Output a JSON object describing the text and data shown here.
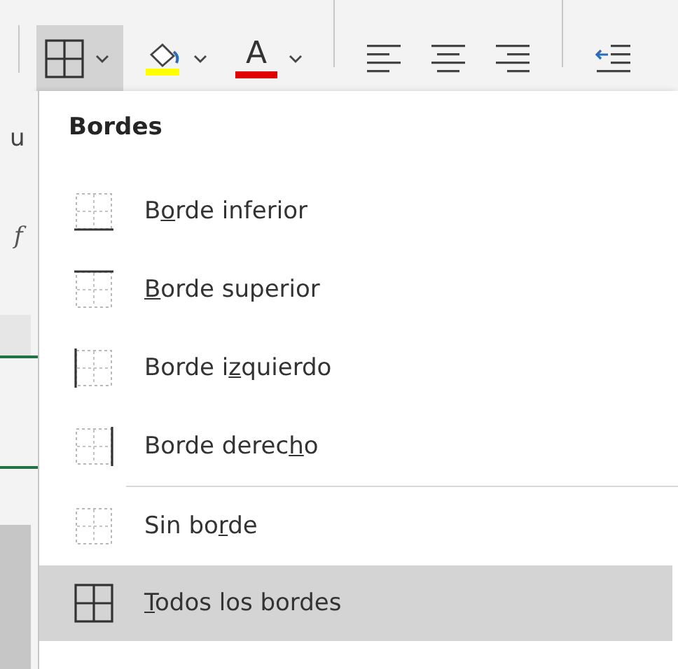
{
  "toolbar": {
    "items": [
      {
        "kind": "borders",
        "pressed": true
      },
      {
        "kind": "fill-color",
        "color": "#ffff00"
      },
      {
        "kind": "font-color",
        "glyph": "A",
        "color": "#e00000"
      },
      {
        "kind": "separator"
      },
      {
        "kind": "align-left"
      },
      {
        "kind": "align-center"
      },
      {
        "kind": "align-right"
      },
      {
        "kind": "separator"
      },
      {
        "kind": "indent"
      }
    ]
  },
  "sheet_edge": {
    "texts": [
      "u",
      "f"
    ]
  },
  "menu": {
    "heading": "Bordes",
    "items": [
      {
        "kind": "bottom",
        "label_parts": [
          {
            "text": "B",
            "underlined": false
          },
          {
            "text": "o",
            "underlined": true
          },
          {
            "text": "rde inferior",
            "underlined": false
          }
        ],
        "separator_before": false,
        "selected": false
      },
      {
        "kind": "top",
        "label_parts": [
          {
            "text": "B",
            "underlined": true
          },
          {
            "text": "orde superior",
            "underlined": false
          }
        ],
        "separator_before": false,
        "selected": false
      },
      {
        "kind": "left",
        "label_parts": [
          {
            "text": "Borde i",
            "underlined": false
          },
          {
            "text": "z",
            "underlined": true
          },
          {
            "text": "quierdo",
            "underlined": false
          }
        ],
        "separator_before": false,
        "selected": false
      },
      {
        "kind": "right",
        "label_parts": [
          {
            "text": "Borde derec",
            "underlined": false
          },
          {
            "text": "h",
            "underlined": true
          },
          {
            "text": "o",
            "underlined": false
          }
        ],
        "separator_before": false,
        "selected": false
      },
      {
        "kind": "none",
        "label_parts": [
          {
            "text": "Sin bo",
            "underlined": false
          },
          {
            "text": "r",
            "underlined": true
          },
          {
            "text": "de",
            "underlined": false
          }
        ],
        "separator_before": true,
        "selected": false
      },
      {
        "kind": "all",
        "label_parts": [
          {
            "text": "T",
            "underlined": true
          },
          {
            "text": "odos los bordes",
            "underlined": false
          }
        ],
        "separator_before": false,
        "selected": true
      }
    ]
  }
}
